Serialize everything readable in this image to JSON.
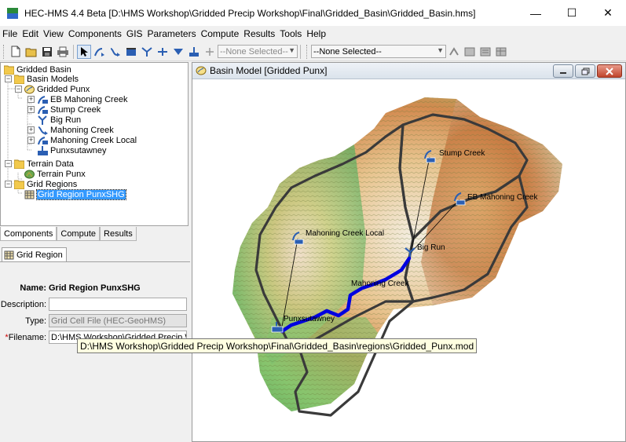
{
  "window": {
    "title": "HEC-HMS 4.4 Beta [D:\\HMS Workshop\\Gridded Precip Workshop\\Final\\Gridded_Basin\\Gridded_Basin.hms]",
    "minimize": "—",
    "maximize": "☐",
    "close": "✕"
  },
  "menu": [
    "File",
    "Edit",
    "View",
    "Components",
    "GIS",
    "Parameters",
    "Compute",
    "Results",
    "Tools",
    "Help"
  ],
  "toolbar": {
    "selector1": "--None Selected--",
    "selector2": "--None Selected--"
  },
  "tree": {
    "items": [
      {
        "label": "Gridded Basin",
        "icon": "folder-icon"
      },
      {
        "label": "Basin Models",
        "icon": "folder-icon"
      },
      {
        "label": "Gridded Punx",
        "icon": "basin-model-icon"
      },
      {
        "label": "EB Mahoning Creek",
        "icon": "subbasin-icon"
      },
      {
        "label": "Stump Creek",
        "icon": "subbasin-icon"
      },
      {
        "label": "Big Run",
        "icon": "junction-icon"
      },
      {
        "label": "Mahoning Creek",
        "icon": "reach-icon"
      },
      {
        "label": "Mahoning Creek Local",
        "icon": "subbasin-icon"
      },
      {
        "label": "Punxsutawney",
        "icon": "sink-icon"
      },
      {
        "label": "Terrain Data",
        "icon": "folder-icon"
      },
      {
        "label": "Terrain Punx",
        "icon": "terrain-icon"
      },
      {
        "label": "Grid Regions",
        "icon": "folder-icon"
      },
      {
        "label": "Grid Region PunxSHG",
        "icon": "grid-icon"
      }
    ]
  },
  "panel_tabs": [
    "Components",
    "Compute",
    "Results"
  ],
  "editor": {
    "tab": "Grid Region",
    "name_label": "Name:",
    "name_value": "Grid Region PunxSHG",
    "description_label": "Description:",
    "description_value": "",
    "type_label": "Type:",
    "type_value": "Grid Cell File (HEC-GeoHMS)",
    "filename_required": "*",
    "filename_label": "Filename:",
    "filename_value": "D:\\HMS Workshop\\Gridded Precip Wo"
  },
  "basin_window": {
    "title": "Basin Model [Gridded Punx]",
    "map_labels": [
      "Stump Creek",
      "EB Mahoning Creek",
      "Mahoning Creek Local",
      "Big Run",
      "Mahoning Creek",
      "Punxsutawney"
    ]
  },
  "tooltip": "D:\\HMS Workshop\\Gridded Precip Workshop\\Final\\Gridded_Basin\\regions\\Gridded_Punx.mod",
  "colors": {
    "selection": "#3399ff",
    "river": "#0000e0",
    "boundary": "#3a3a3a"
  }
}
